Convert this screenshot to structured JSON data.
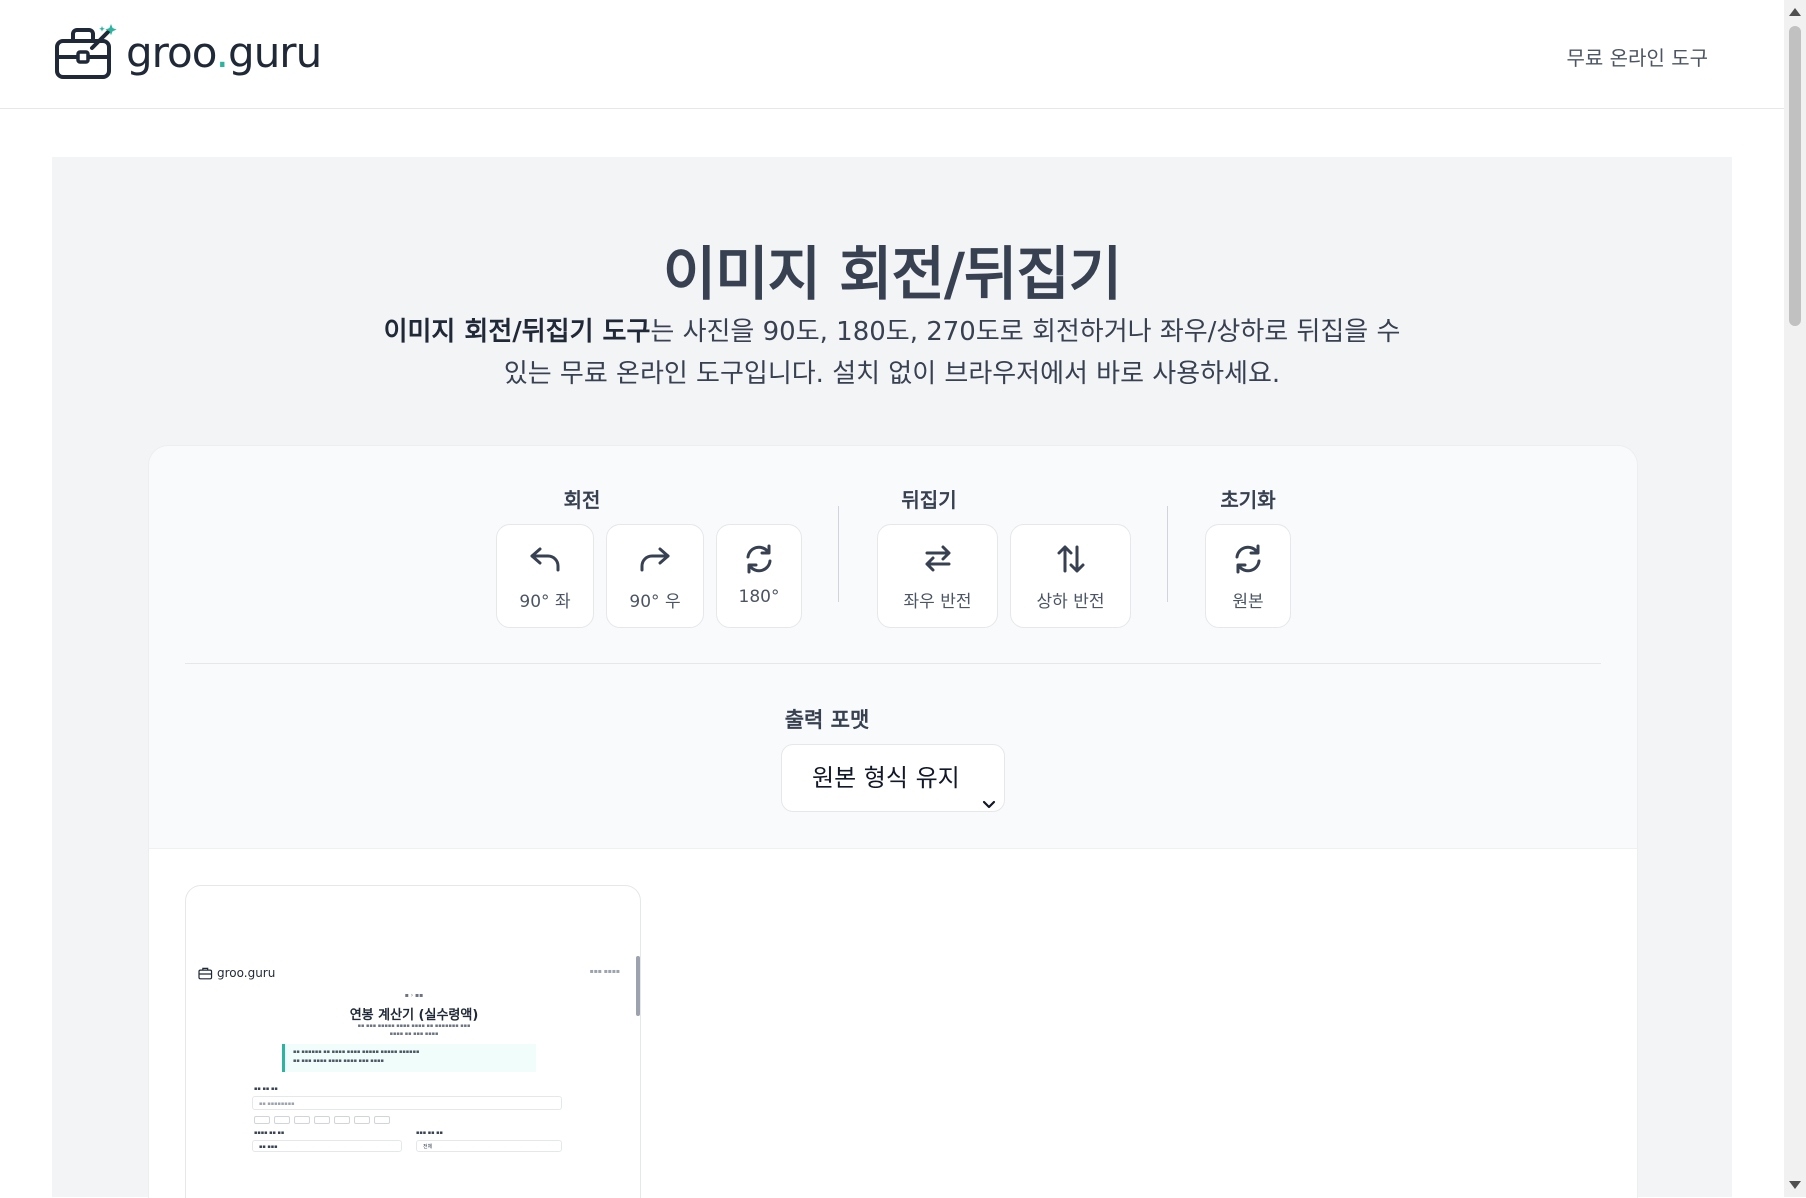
{
  "header": {
    "logo_text_main": "groo",
    "logo_text_dot": ".",
    "logo_text_tail": "guru",
    "nav_link": "무료 온라인 도구"
  },
  "hero": {
    "title": "이미지 회전/뒤집기",
    "desc_bold": "이미지 회전/뒤집기 도구",
    "desc_rest": "는 사진을 90도, 180도, 270도로 회전하거나 좌우/상하로 뒤집을 수 있는 무료 온라인 도구입니다. 설치 없이 브라우저에서 바로 사용하세요."
  },
  "controls": {
    "rotate": {
      "label": "회전",
      "buttons": [
        {
          "label": "90° 좌",
          "icon": "rotate-left-icon"
        },
        {
          "label": "90° 우",
          "icon": "rotate-right-icon"
        },
        {
          "label": "180°",
          "icon": "rotate-180-icon"
        }
      ]
    },
    "flip": {
      "label": "뒤집기",
      "buttons": [
        {
          "label": "좌우 반전",
          "icon": "flip-horizontal-icon"
        },
        {
          "label": "상하 반전",
          "icon": "flip-vertical-icon"
        }
      ]
    },
    "reset": {
      "label": "초기화",
      "buttons": [
        {
          "label": "원본",
          "icon": "reset-icon"
        }
      ]
    }
  },
  "output": {
    "label": "출력 포맷",
    "selected": "원본 형식 유지"
  },
  "preview": {
    "logo_text": "groo.guru",
    "title": "연봉 계산기 (실수령액)",
    "select_value": "전체"
  },
  "colors": {
    "accent": "#2bb5a0",
    "panel_bg": "#f3f4f6",
    "card_bg": "#f9fafb",
    "text": "#374151"
  }
}
